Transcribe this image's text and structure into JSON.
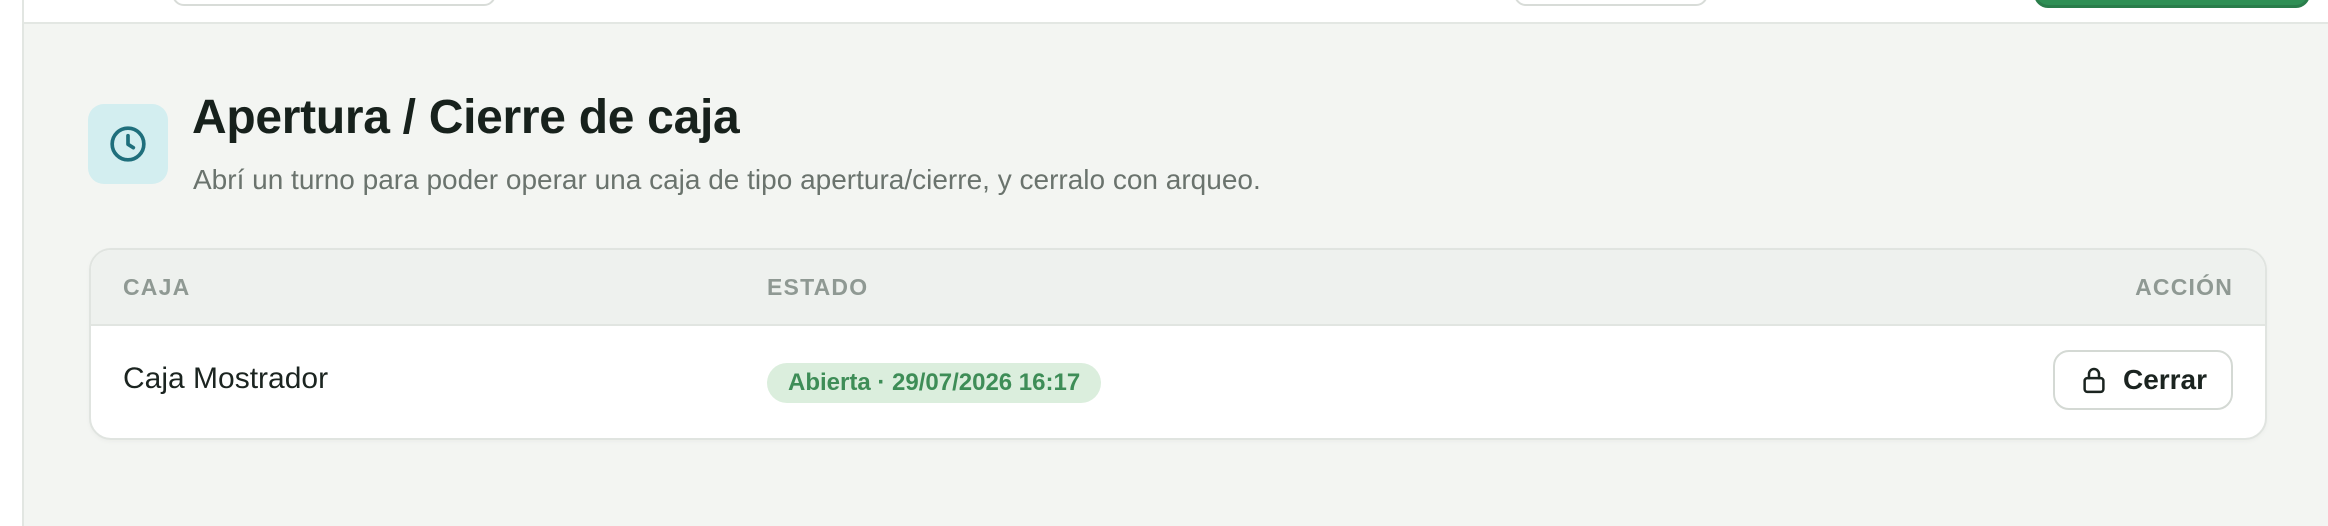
{
  "page": {
    "title": "Apertura / Cierre de caja",
    "subtitle": "Abrí un turno para poder operar una caja de tipo apertura/cierre, y cerralo con arqueo.",
    "icon": "clock-icon"
  },
  "table": {
    "columns": [
      "CAJA",
      "ESTADO",
      "ACCIÓN"
    ],
    "rows": [
      {
        "caja": "Caja Mostrador",
        "estado": "Abierta · 29/07/2026 16:17",
        "accion": "Cerrar",
        "accion_icon": "lock-icon"
      }
    ]
  },
  "colors": {
    "background": "#f3f5f2",
    "accent_icon_bg": "#d3eef0",
    "accent_icon": "#1f6f7c",
    "status_bg": "#dbeedd",
    "status_text": "#3e8d57",
    "primary": "#2f8f55"
  }
}
